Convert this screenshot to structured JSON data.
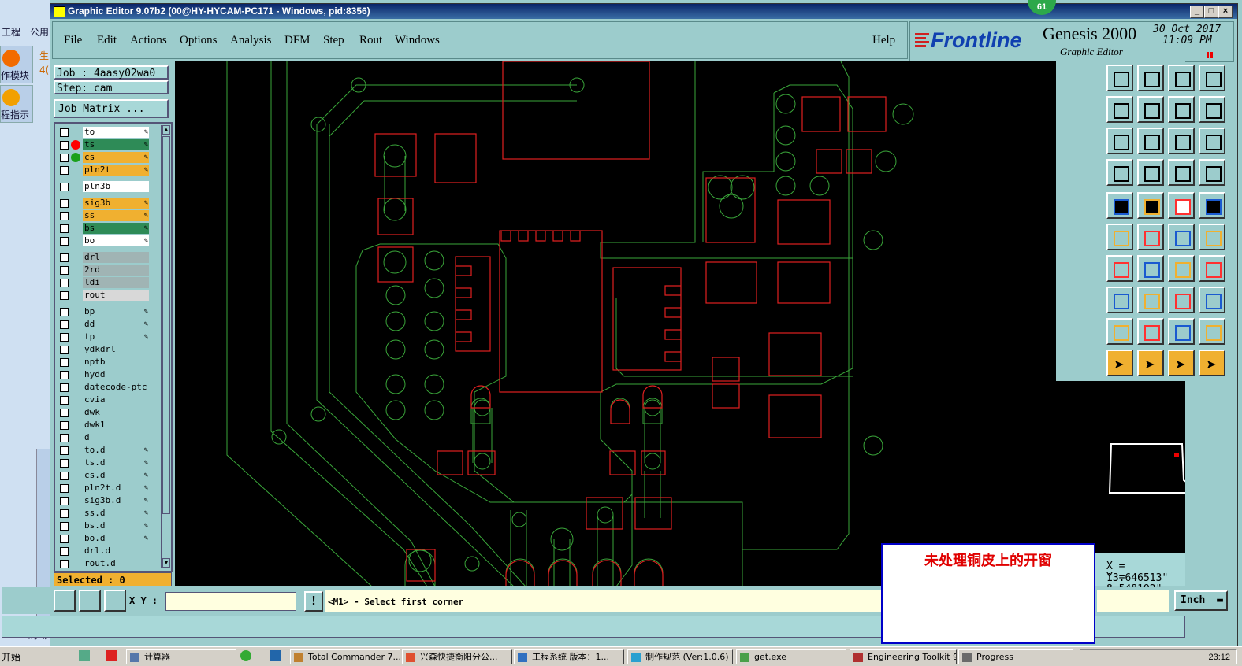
{
  "window": {
    "title": "Graphic Editor 9.07b2 (00@HY-HYCAM-PC171 - Windows, pid:8356)",
    "badge": "61"
  },
  "background_app": {
    "tab1": "工程",
    "tab2": "公用",
    "module1": "作模块",
    "module2": "程指示",
    "label_a": "生",
    "label_b": "4(",
    "bottom_tab": "局域",
    "start": "开始"
  },
  "menu": {
    "file": "File",
    "edit": "Edit",
    "actions": "Actions",
    "options": "Options",
    "analysis": "Analysis",
    "dfm": "DFM",
    "step": "Step",
    "rout": "Rout",
    "windows": "Windows",
    "help": "Help"
  },
  "logo": {
    "brand": "Frontline",
    "product": "Genesis 2000",
    "subtitle": "Graphic Editor",
    "date": "30 Oct 2017",
    "time": "11:09 PM"
  },
  "job": {
    "job_label": "Job : 4aasy02wa0",
    "step_label": "Step: cam",
    "matrix_button": "Job Matrix ...",
    "selected": "Selected : 0"
  },
  "layers": [
    {
      "name": "to",
      "bg": "#ffffff",
      "dot": "",
      "pen": true
    },
    {
      "name": "ts",
      "bg": "#2e8b57",
      "dot": "#ff0000",
      "pen": true,
      "checked": true
    },
    {
      "name": "cs",
      "bg": "#f0b030",
      "dot": "#1aa01a",
      "pen": true
    },
    {
      "name": "pln2t",
      "bg": "#f0b030",
      "dot": "",
      "pen": true
    },
    {
      "name": "pln3b",
      "bg": "#ffffff",
      "dot": "",
      "pen": false
    },
    {
      "name": "sig3b",
      "bg": "#f0b030",
      "dot": "",
      "pen": true
    },
    {
      "name": "ss",
      "bg": "#f0b030",
      "dot": "",
      "pen": true
    },
    {
      "name": "bs",
      "bg": "#2e8b57",
      "dot": "",
      "pen": true
    },
    {
      "name": "bo",
      "bg": "#ffffff",
      "dot": "",
      "pen": true
    },
    {
      "name": "drl",
      "bg": "#a0b4b4",
      "dot": "",
      "pen": false
    },
    {
      "name": "2rd",
      "bg": "#a0b4b4",
      "dot": "",
      "pen": false
    },
    {
      "name": "ldi",
      "bg": "#a0b4b4",
      "dot": "",
      "pen": false
    },
    {
      "name": "rout",
      "bg": "#d8d8d8",
      "dot": "",
      "pen": false
    },
    {
      "name": "bp",
      "bg": "#9ccccc",
      "dot": "",
      "pen": true
    },
    {
      "name": "dd",
      "bg": "#9ccccc",
      "dot": "",
      "pen": true
    },
    {
      "name": "tp",
      "bg": "#9ccccc",
      "dot": "",
      "pen": true
    },
    {
      "name": "ydkdrl",
      "bg": "#9ccccc",
      "dot": "",
      "pen": false
    },
    {
      "name": "nptb",
      "bg": "#9ccccc",
      "dot": "",
      "pen": false
    },
    {
      "name": "hydd",
      "bg": "#9ccccc",
      "dot": "",
      "pen": false
    },
    {
      "name": "datecode-ptc",
      "bg": "#9ccccc",
      "dot": "",
      "pen": false
    },
    {
      "name": "cvia",
      "bg": "#9ccccc",
      "dot": "",
      "pen": false
    },
    {
      "name": "dwk",
      "bg": "#9ccccc",
      "dot": "",
      "pen": false
    },
    {
      "name": "dwk1",
      "bg": "#9ccccc",
      "dot": "",
      "pen": false
    },
    {
      "name": "d",
      "bg": "#9ccccc",
      "dot": "",
      "pen": false
    },
    {
      "name": "to.d",
      "bg": "#9ccccc",
      "dot": "",
      "pen": true
    },
    {
      "name": "ts.d",
      "bg": "#9ccccc",
      "dot": "",
      "pen": true
    },
    {
      "name": "cs.d",
      "bg": "#9ccccc",
      "dot": "",
      "pen": true
    },
    {
      "name": "pln2t.d",
      "bg": "#9ccccc",
      "dot": "",
      "pen": true
    },
    {
      "name": "sig3b.d",
      "bg": "#9ccccc",
      "dot": "",
      "pen": true
    },
    {
      "name": "ss.d",
      "bg": "#9ccccc",
      "dot": "",
      "pen": true
    },
    {
      "name": "bs.d",
      "bg": "#9ccccc",
      "dot": "",
      "pen": true
    },
    {
      "name": "bo.d",
      "bg": "#9ccccc",
      "dot": "",
      "pen": true
    },
    {
      "name": "drl.d",
      "bg": "#9ccccc",
      "dot": "",
      "pen": false
    },
    {
      "name": "rout.d",
      "bg": "#9ccccc",
      "dot": "",
      "pen": false
    }
  ],
  "coords": {
    "x": "X = 13.646513\"",
    "y": "Y = 8.548192\""
  },
  "command": {
    "xy_label": "X Y :",
    "xy_value": "",
    "prompt": "<M1> - Select first corner",
    "units": "Inch"
  },
  "annotation": "未处理铜皮上的开窗",
  "taskbar": {
    "items": [
      "计算器",
      "Total Commander 7....",
      "兴森快捷衡阳分公...",
      "工程系统  版本：1...",
      "制作规范 (Ver:1.0.6)",
      "get.exe",
      "Engineering Toolkit 9...",
      "Progress"
    ],
    "clock": "23:12"
  },
  "colors": {
    "panel": "#9ccccc",
    "canvas": "#000000",
    "line_green": "#3aa63a",
    "pad_red": "#e02020"
  }
}
